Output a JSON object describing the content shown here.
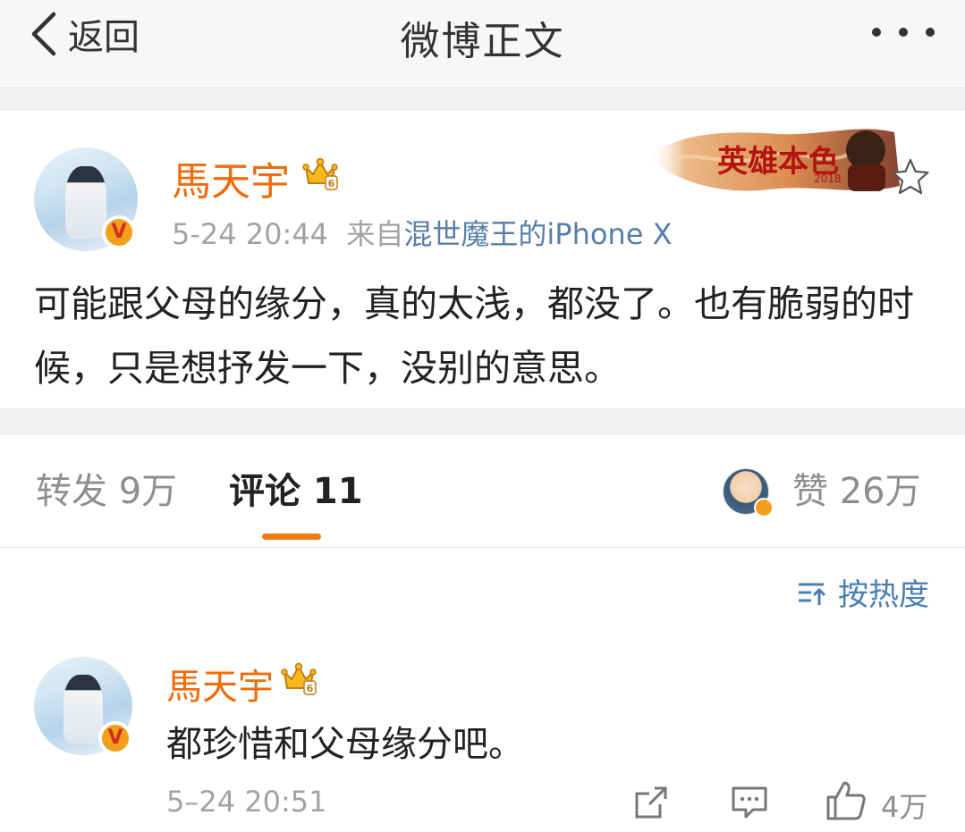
{
  "nav": {
    "back_label": "返回",
    "title": "微博正文"
  },
  "post": {
    "username": "馬天宇",
    "time": "5-24 20:44",
    "source_prefix": "来自",
    "source": "混世魔王的iPhone X",
    "text": "可能跟父母的缘分，真的太浅，都没了。也有脆弱的时候，只是想抒发一下，没别的意思。",
    "banner_text": "英雄本色",
    "banner_year": "2018",
    "crown_level": "6"
  },
  "tabs": {
    "repost": "转发 9万",
    "comment": "评论 11",
    "like": "赞 26万"
  },
  "sort": {
    "label": "按热度"
  },
  "comment": {
    "username": "馬天宇",
    "text": "都珍惜和父母缘分吧。",
    "time": "5–24 20:51",
    "like_count": "4万"
  },
  "colors": {
    "username": "#f06b0b",
    "link": "#577fa8",
    "accent": "#f07b12",
    "sort": "#4a7fb2",
    "meta": "#a3a3a3"
  }
}
